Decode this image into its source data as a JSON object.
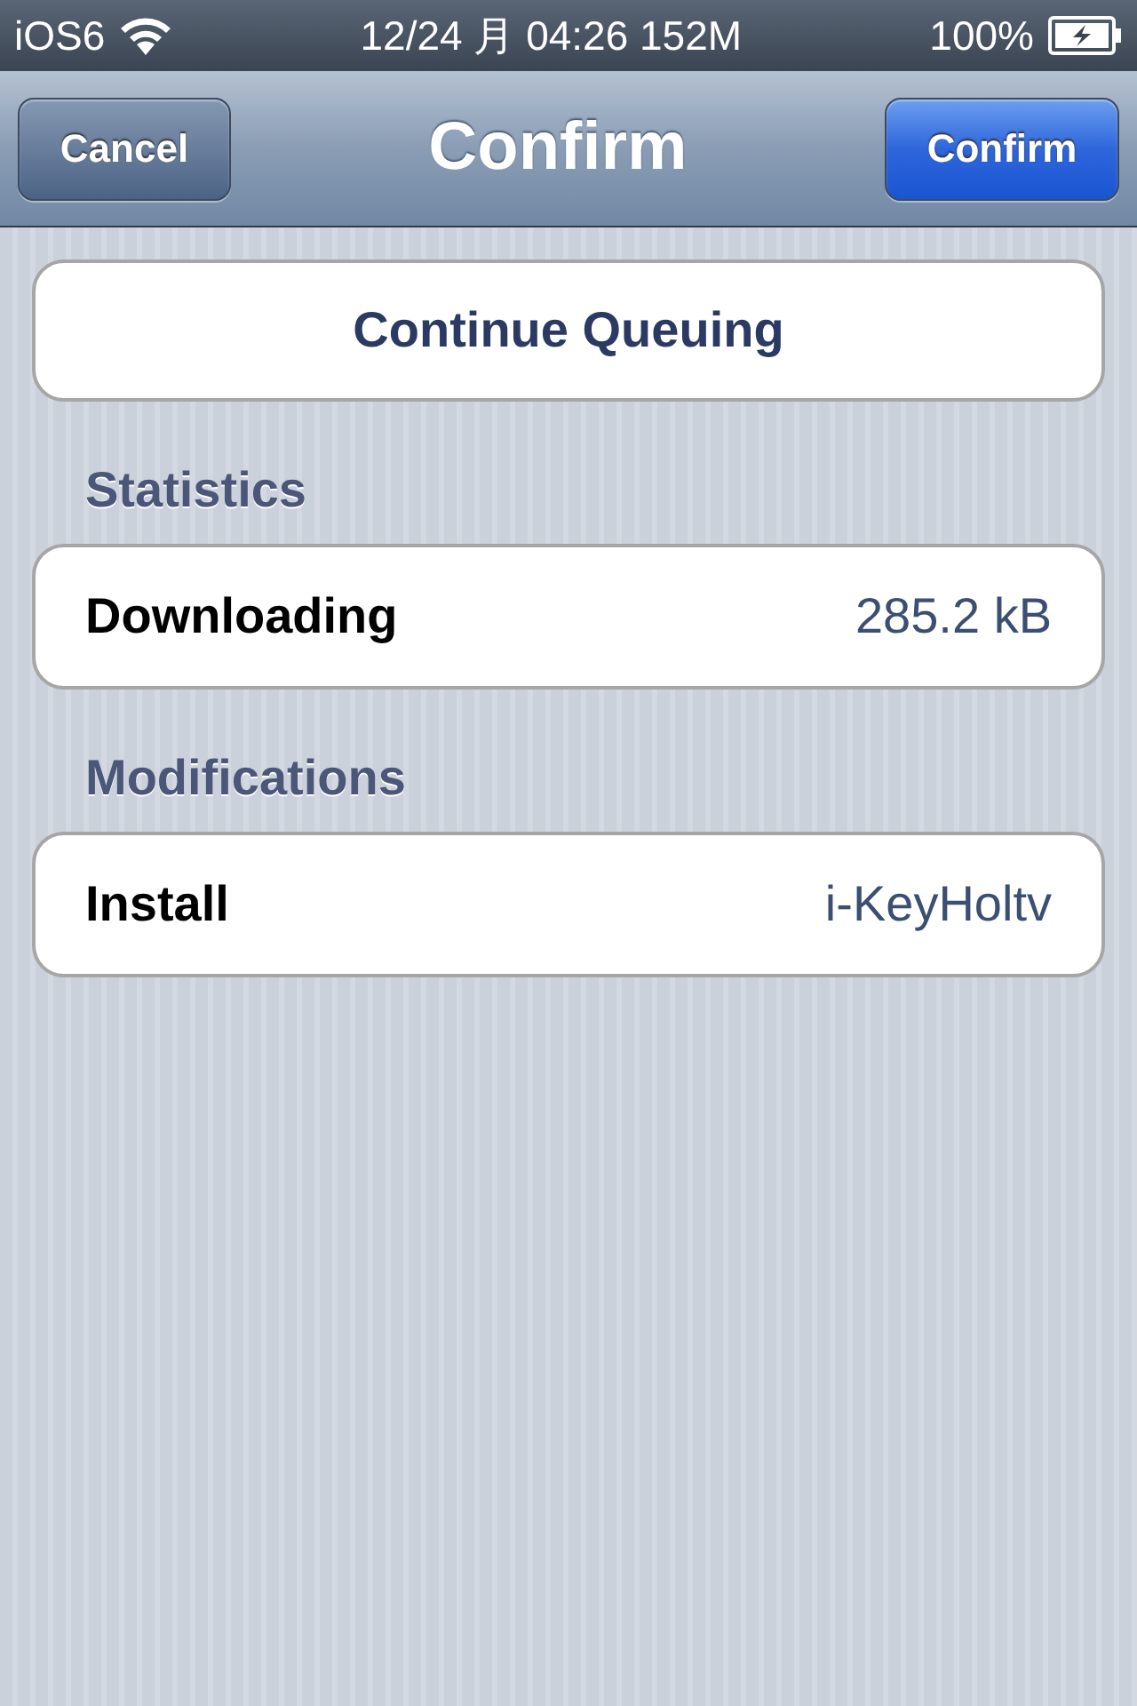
{
  "status_bar": {
    "carrier": "iOS6",
    "time": "12/24 月 04:26 152M",
    "battery": "100%"
  },
  "nav_bar": {
    "left_button": "Cancel",
    "title": "Confirm",
    "right_button": "Confirm"
  },
  "action_button": "Continue Queuing",
  "sections": [
    {
      "header": "Statistics",
      "rows": [
        {
          "label": "Downloading",
          "value": "285.2 kB"
        }
      ]
    },
    {
      "header": "Modifications",
      "rows": [
        {
          "label": "Install",
          "value": "i-KeyHoltv"
        }
      ]
    }
  ]
}
